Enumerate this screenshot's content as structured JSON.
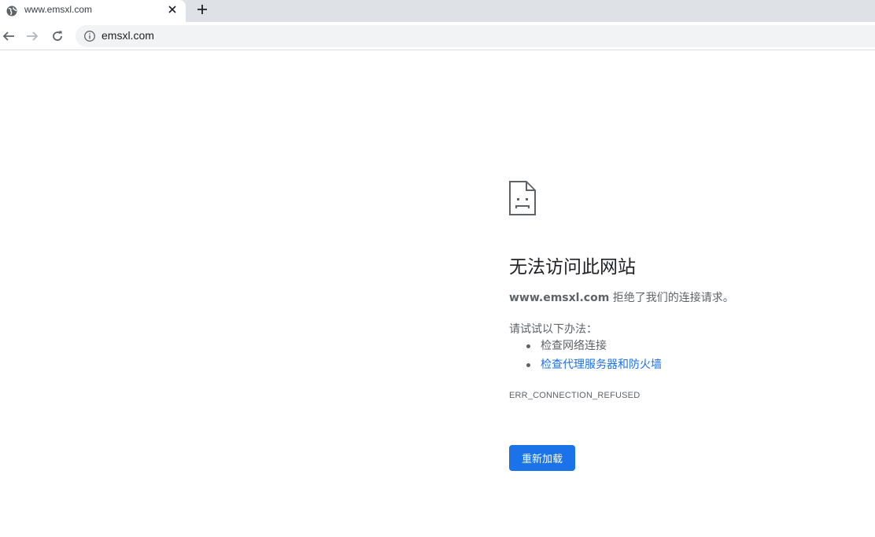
{
  "tab": {
    "title": "www.emsxl.com",
    "favicon": "globe-icon"
  },
  "toolbar": {
    "url": "emsxl.com"
  },
  "error": {
    "title": "无法访问此网站",
    "host": "www.emsxl.com",
    "summary_rest": " 拒绝了我们的连接请求。",
    "try_title": "请试试以下办法：",
    "suggestions": [
      {
        "label": "检查网络连接",
        "link": false
      },
      {
        "label": "检查代理服务器和防火墙",
        "link": true
      }
    ],
    "code": "ERR_CONNECTION_REFUSED",
    "reload_label": "重新加载"
  },
  "colors": {
    "tabstrip": "#dee1e6",
    "omnibox": "#f1f3f4",
    "accent": "#1a73e8",
    "text_secondary": "#5f6368"
  }
}
